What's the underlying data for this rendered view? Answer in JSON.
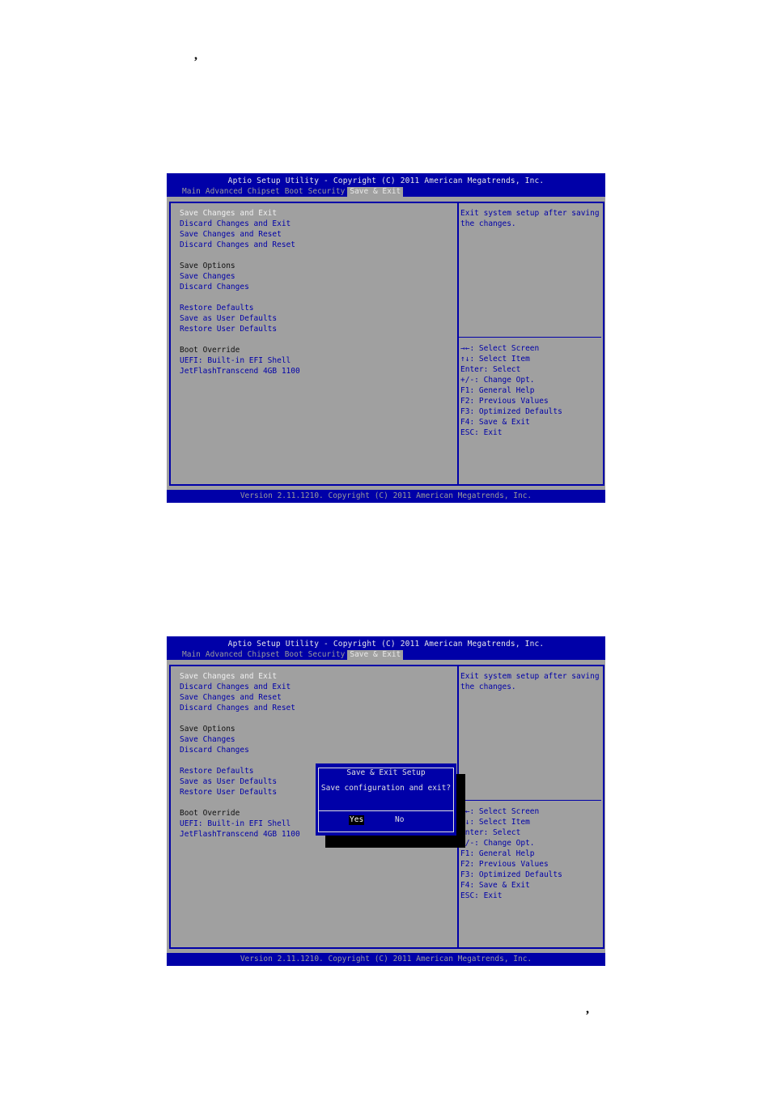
{
  "page": {
    "top_mark": ",",
    "bottom_mark": ","
  },
  "screen1": {
    "title": "Aptio Setup Utility - Copyright (C) 2011 American Megatrends, Inc.",
    "tabs": [
      "Main",
      "Advanced",
      "Chipset",
      "Boot",
      "Security",
      "Save & Exit"
    ],
    "active_tab": "Save & Exit",
    "items": [
      {
        "label": "Save Changes and Exit",
        "type": "selected"
      },
      {
        "label": "Discard Changes and Exit",
        "type": "option"
      },
      {
        "label": "Save Changes and Reset",
        "type": "option"
      },
      {
        "label": "Discard Changes and Reset",
        "type": "option"
      },
      {
        "label": "",
        "type": "blank"
      },
      {
        "label": "Save Options",
        "type": "header"
      },
      {
        "label": "Save Changes",
        "type": "option"
      },
      {
        "label": "Discard Changes",
        "type": "option"
      },
      {
        "label": "",
        "type": "blank"
      },
      {
        "label": "Restore Defaults",
        "type": "option"
      },
      {
        "label": "Save as User Defaults",
        "type": "option"
      },
      {
        "label": "Restore User Defaults",
        "type": "option"
      },
      {
        "label": "",
        "type": "blank"
      },
      {
        "label": "Boot Override",
        "type": "header"
      },
      {
        "label": "UEFI: Built-in EFI Shell",
        "type": "option"
      },
      {
        "label": "JetFlashTranscend 4GB 1100",
        "type": "option"
      }
    ],
    "help_text": "Exit system setup after saving the changes.",
    "keys": [
      "→←: Select Screen",
      "↑↓: Select Item",
      "Enter: Select",
      "+/-: Change Opt.",
      "F1: General Help",
      "F2: Previous Values",
      "F3: Optimized Defaults",
      "F4: Save & Exit",
      "ESC: Exit"
    ],
    "footer": "Version 2.11.1210. Copyright (C) 2011 American Megatrends, Inc."
  },
  "screen2": {
    "title": "Aptio Setup Utility - Copyright (C) 2011 American Megatrends, Inc.",
    "tabs": [
      "Main",
      "Advanced",
      "Chipset",
      "Boot",
      "Security",
      "Save & Exit"
    ],
    "items": [
      "Save Changes and Exit",
      "Discard Changes and Exit",
      "Save Changes and Reset",
      "Discard Changes and Reset",
      "",
      "Save Options",
      "Save Changes",
      "Discard Changes",
      "",
      "Restore Defaults",
      "Save as User Defaults",
      "Restore User Defaults",
      "",
      "Boot Override",
      "UEFI: Built-in EFI Shell",
      "JetFlashTranscend 4GB 1100"
    ],
    "help_text": "Exit system setup after saving the changes.",
    "keys": [
      "→←: Select Screen",
      "↑↓: Select Item",
      "Enter: Select",
      "+/-: Change Opt.",
      "F1: General Help",
      "F2: Previous Values",
      "F3: Optimized Defaults",
      "F4: Save & Exit",
      "ESC: Exit"
    ],
    "footer": "Version 2.11.1210. Copyright (C) 2011 American Megatrends, Inc.",
    "dialog": {
      "title": "Save & Exit Setup",
      "message": "Save configuration and exit?",
      "yes": "Yes",
      "no": "No"
    }
  },
  "colors": {
    "bios_blue": "#0000a8",
    "bios_gray": "#a0a0a0",
    "highlight_text": "#f0f0f0"
  }
}
